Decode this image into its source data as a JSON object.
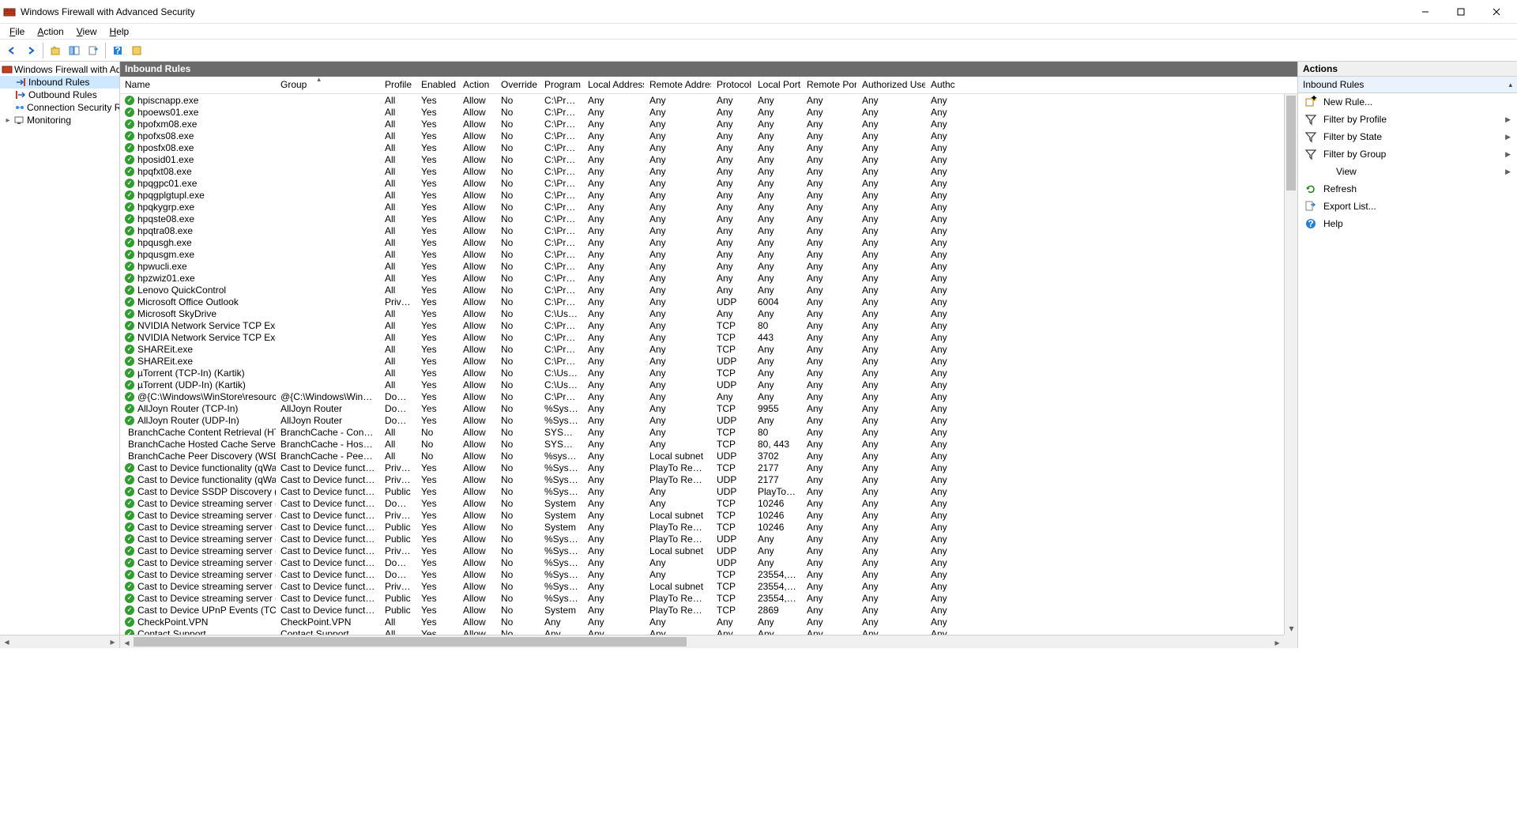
{
  "window": {
    "title": "Windows Firewall with Advanced Security"
  },
  "menu": [
    "File",
    "Action",
    "View",
    "Help"
  ],
  "tree": {
    "root": "Windows Firewall with Advance",
    "items": [
      "Inbound Rules",
      "Outbound Rules",
      "Connection Security Rules",
      "Monitoring"
    ]
  },
  "list_title": "Inbound Rules",
  "columns": [
    "Name",
    "Group",
    "Profile",
    "Enabled",
    "Action",
    "Override",
    "Program",
    "Local Address",
    "Remote Address",
    "Protocol",
    "Local Port",
    "Remote Port",
    "Authorized Users",
    "Authc"
  ],
  "rules": [
    {
      "icon": "on",
      "name": "hpiscnapp.exe",
      "group": "",
      "profile": "All",
      "enabled": "Yes",
      "action": "Allow",
      "override": "No",
      "program": "C:\\Progr...",
      "laddr": "Any",
      "raddr": "Any",
      "proto": "Any",
      "lport": "Any",
      "rport": "Any",
      "auth": "Any",
      "authc": "Any"
    },
    {
      "icon": "on",
      "name": "hpoews01.exe",
      "group": "",
      "profile": "All",
      "enabled": "Yes",
      "action": "Allow",
      "override": "No",
      "program": "C:\\Progr...",
      "laddr": "Any",
      "raddr": "Any",
      "proto": "Any",
      "lport": "Any",
      "rport": "Any",
      "auth": "Any",
      "authc": "Any"
    },
    {
      "icon": "on",
      "name": "hpofxm08.exe",
      "group": "",
      "profile": "All",
      "enabled": "Yes",
      "action": "Allow",
      "override": "No",
      "program": "C:\\Progr...",
      "laddr": "Any",
      "raddr": "Any",
      "proto": "Any",
      "lport": "Any",
      "rport": "Any",
      "auth": "Any",
      "authc": "Any"
    },
    {
      "icon": "on",
      "name": "hpofxs08.exe",
      "group": "",
      "profile": "All",
      "enabled": "Yes",
      "action": "Allow",
      "override": "No",
      "program": "C:\\Progr...",
      "laddr": "Any",
      "raddr": "Any",
      "proto": "Any",
      "lport": "Any",
      "rport": "Any",
      "auth": "Any",
      "authc": "Any"
    },
    {
      "icon": "on",
      "name": "hposfx08.exe",
      "group": "",
      "profile": "All",
      "enabled": "Yes",
      "action": "Allow",
      "override": "No",
      "program": "C:\\Progr...",
      "laddr": "Any",
      "raddr": "Any",
      "proto": "Any",
      "lport": "Any",
      "rport": "Any",
      "auth": "Any",
      "authc": "Any"
    },
    {
      "icon": "on",
      "name": "hposid01.exe",
      "group": "",
      "profile": "All",
      "enabled": "Yes",
      "action": "Allow",
      "override": "No",
      "program": "C:\\Progr...",
      "laddr": "Any",
      "raddr": "Any",
      "proto": "Any",
      "lport": "Any",
      "rport": "Any",
      "auth": "Any",
      "authc": "Any"
    },
    {
      "icon": "on",
      "name": "hpqfxt08.exe",
      "group": "",
      "profile": "All",
      "enabled": "Yes",
      "action": "Allow",
      "override": "No",
      "program": "C:\\Progr...",
      "laddr": "Any",
      "raddr": "Any",
      "proto": "Any",
      "lport": "Any",
      "rport": "Any",
      "auth": "Any",
      "authc": "Any"
    },
    {
      "icon": "on",
      "name": "hpqgpc01.exe",
      "group": "",
      "profile": "All",
      "enabled": "Yes",
      "action": "Allow",
      "override": "No",
      "program": "C:\\Progr...",
      "laddr": "Any",
      "raddr": "Any",
      "proto": "Any",
      "lport": "Any",
      "rport": "Any",
      "auth": "Any",
      "authc": "Any"
    },
    {
      "icon": "on",
      "name": "hpqgplgtupl.exe",
      "group": "",
      "profile": "All",
      "enabled": "Yes",
      "action": "Allow",
      "override": "No",
      "program": "C:\\Progr...",
      "laddr": "Any",
      "raddr": "Any",
      "proto": "Any",
      "lport": "Any",
      "rport": "Any",
      "auth": "Any",
      "authc": "Any"
    },
    {
      "icon": "on",
      "name": "hpqkygrp.exe",
      "group": "",
      "profile": "All",
      "enabled": "Yes",
      "action": "Allow",
      "override": "No",
      "program": "C:\\Progr...",
      "laddr": "Any",
      "raddr": "Any",
      "proto": "Any",
      "lport": "Any",
      "rport": "Any",
      "auth": "Any",
      "authc": "Any"
    },
    {
      "icon": "on",
      "name": "hpqste08.exe",
      "group": "",
      "profile": "All",
      "enabled": "Yes",
      "action": "Allow",
      "override": "No",
      "program": "C:\\Progr...",
      "laddr": "Any",
      "raddr": "Any",
      "proto": "Any",
      "lport": "Any",
      "rport": "Any",
      "auth": "Any",
      "authc": "Any"
    },
    {
      "icon": "on",
      "name": "hpqtra08.exe",
      "group": "",
      "profile": "All",
      "enabled": "Yes",
      "action": "Allow",
      "override": "No",
      "program": "C:\\Progr...",
      "laddr": "Any",
      "raddr": "Any",
      "proto": "Any",
      "lport": "Any",
      "rport": "Any",
      "auth": "Any",
      "authc": "Any"
    },
    {
      "icon": "on",
      "name": "hpqusgh.exe",
      "group": "",
      "profile": "All",
      "enabled": "Yes",
      "action": "Allow",
      "override": "No",
      "program": "C:\\Progr...",
      "laddr": "Any",
      "raddr": "Any",
      "proto": "Any",
      "lport": "Any",
      "rport": "Any",
      "auth": "Any",
      "authc": "Any"
    },
    {
      "icon": "on",
      "name": "hpqusgm.exe",
      "group": "",
      "profile": "All",
      "enabled": "Yes",
      "action": "Allow",
      "override": "No",
      "program": "C:\\Progr...",
      "laddr": "Any",
      "raddr": "Any",
      "proto": "Any",
      "lport": "Any",
      "rport": "Any",
      "auth": "Any",
      "authc": "Any"
    },
    {
      "icon": "on",
      "name": "hpwucli.exe",
      "group": "",
      "profile": "All",
      "enabled": "Yes",
      "action": "Allow",
      "override": "No",
      "program": "C:\\Progr...",
      "laddr": "Any",
      "raddr": "Any",
      "proto": "Any",
      "lport": "Any",
      "rport": "Any",
      "auth": "Any",
      "authc": "Any"
    },
    {
      "icon": "on",
      "name": "hpzwiz01.exe",
      "group": "",
      "profile": "All",
      "enabled": "Yes",
      "action": "Allow",
      "override": "No",
      "program": "C:\\Progr...",
      "laddr": "Any",
      "raddr": "Any",
      "proto": "Any",
      "lport": "Any",
      "rport": "Any",
      "auth": "Any",
      "authc": "Any"
    },
    {
      "icon": "on",
      "name": "Lenovo QuickControl",
      "group": "",
      "profile": "All",
      "enabled": "Yes",
      "action": "Allow",
      "override": "No",
      "program": "C:\\Progr...",
      "laddr": "Any",
      "raddr": "Any",
      "proto": "Any",
      "lport": "Any",
      "rport": "Any",
      "auth": "Any",
      "authc": "Any"
    },
    {
      "icon": "on",
      "name": "Microsoft Office Outlook",
      "group": "",
      "profile": "Private",
      "enabled": "Yes",
      "action": "Allow",
      "override": "No",
      "program": "C:\\Progr...",
      "laddr": "Any",
      "raddr": "Any",
      "proto": "UDP",
      "lport": "6004",
      "rport": "Any",
      "auth": "Any",
      "authc": "Any"
    },
    {
      "icon": "on",
      "name": "Microsoft SkyDrive",
      "group": "",
      "profile": "All",
      "enabled": "Yes",
      "action": "Allow",
      "override": "No",
      "program": "C:\\Users\\...",
      "laddr": "Any",
      "raddr": "Any",
      "proto": "Any",
      "lport": "Any",
      "rport": "Any",
      "auth": "Any",
      "authc": "Any"
    },
    {
      "icon": "on",
      "name": "NVIDIA Network Service TCP Exception (...",
      "group": "",
      "profile": "All",
      "enabled": "Yes",
      "action": "Allow",
      "override": "No",
      "program": "C:\\Progr...",
      "laddr": "Any",
      "raddr": "Any",
      "proto": "TCP",
      "lport": "80",
      "rport": "Any",
      "auth": "Any",
      "authc": "Any"
    },
    {
      "icon": "on",
      "name": "NVIDIA Network Service TCP Exception (...",
      "group": "",
      "profile": "All",
      "enabled": "Yes",
      "action": "Allow",
      "override": "No",
      "program": "C:\\Progr...",
      "laddr": "Any",
      "raddr": "Any",
      "proto": "TCP",
      "lport": "443",
      "rport": "Any",
      "auth": "Any",
      "authc": "Any"
    },
    {
      "icon": "on",
      "name": "SHAREit.exe",
      "group": "",
      "profile": "All",
      "enabled": "Yes",
      "action": "Allow",
      "override": "No",
      "program": "C:\\Progr...",
      "laddr": "Any",
      "raddr": "Any",
      "proto": "TCP",
      "lport": "Any",
      "rport": "Any",
      "auth": "Any",
      "authc": "Any"
    },
    {
      "icon": "on",
      "name": "SHAREit.exe",
      "group": "",
      "profile": "All",
      "enabled": "Yes",
      "action": "Allow",
      "override": "No",
      "program": "C:\\Progr...",
      "laddr": "Any",
      "raddr": "Any",
      "proto": "UDP",
      "lport": "Any",
      "rport": "Any",
      "auth": "Any",
      "authc": "Any"
    },
    {
      "icon": "on",
      "name": "µTorrent (TCP-In) (Kartik)",
      "group": "",
      "profile": "All",
      "enabled": "Yes",
      "action": "Allow",
      "override": "No",
      "program": "C:\\Users\\...",
      "laddr": "Any",
      "raddr": "Any",
      "proto": "TCP",
      "lport": "Any",
      "rport": "Any",
      "auth": "Any",
      "authc": "Any"
    },
    {
      "icon": "on",
      "name": "µTorrent (UDP-In) (Kartik)",
      "group": "",
      "profile": "All",
      "enabled": "Yes",
      "action": "Allow",
      "override": "No",
      "program": "C:\\Users\\...",
      "laddr": "Any",
      "raddr": "Any",
      "proto": "UDP",
      "lport": "Any",
      "rport": "Any",
      "auth": "Any",
      "authc": "Any"
    },
    {
      "icon": "on",
      "name": "@{C:\\Windows\\WinStore\\resources.pri?...",
      "group": "@{C:\\Windows\\WinStore\\resources...",
      "profile": "Domai...",
      "enabled": "Yes",
      "action": "Allow",
      "override": "No",
      "program": "C:\\Progr...",
      "laddr": "Any",
      "raddr": "Any",
      "proto": "Any",
      "lport": "Any",
      "rport": "Any",
      "auth": "Any",
      "authc": "Any"
    },
    {
      "icon": "on",
      "name": "AllJoyn Router (TCP-In)",
      "group": "AllJoyn Router",
      "profile": "Domai...",
      "enabled": "Yes",
      "action": "Allow",
      "override": "No",
      "program": "%System...",
      "laddr": "Any",
      "raddr": "Any",
      "proto": "TCP",
      "lport": "9955",
      "rport": "Any",
      "auth": "Any",
      "authc": "Any"
    },
    {
      "icon": "on",
      "name": "AllJoyn Router (UDP-In)",
      "group": "AllJoyn Router",
      "profile": "Domai...",
      "enabled": "Yes",
      "action": "Allow",
      "override": "No",
      "program": "%System...",
      "laddr": "Any",
      "raddr": "Any",
      "proto": "UDP",
      "lport": "Any",
      "rport": "Any",
      "auth": "Any",
      "authc": "Any"
    },
    {
      "icon": "off",
      "name": "BranchCache Content Retrieval (HTTP-In)",
      "group": "BranchCache - Content Retr...",
      "profile": "All",
      "enabled": "No",
      "action": "Allow",
      "override": "No",
      "program": "SYSTEM",
      "laddr": "Any",
      "raddr": "Any",
      "proto": "TCP",
      "lport": "80",
      "rport": "Any",
      "auth": "Any",
      "authc": "Any"
    },
    {
      "icon": "off",
      "name": "BranchCache Hosted Cache Server (HTT...",
      "group": "BranchCache - Hosted Cach...",
      "profile": "All",
      "enabled": "No",
      "action": "Allow",
      "override": "No",
      "program": "SYSTEM",
      "laddr": "Any",
      "raddr": "Any",
      "proto": "TCP",
      "lport": "80, 443",
      "rport": "Any",
      "auth": "Any",
      "authc": "Any"
    },
    {
      "icon": "off",
      "name": "BranchCache Peer Discovery (WSD-In)",
      "group": "BranchCache - Peer Discove...",
      "profile": "All",
      "enabled": "No",
      "action": "Allow",
      "override": "No",
      "program": "%system...",
      "laddr": "Any",
      "raddr": "Local subnet",
      "proto": "UDP",
      "lport": "3702",
      "rport": "Any",
      "auth": "Any",
      "authc": "Any"
    },
    {
      "icon": "on",
      "name": "Cast to Device functionality (qWave-TCP...",
      "group": "Cast to Device functionality",
      "profile": "Private...",
      "enabled": "Yes",
      "action": "Allow",
      "override": "No",
      "program": "%System...",
      "laddr": "Any",
      "raddr": "PlayTo Renderers",
      "proto": "TCP",
      "lport": "2177",
      "rport": "Any",
      "auth": "Any",
      "authc": "Any"
    },
    {
      "icon": "on",
      "name": "Cast to Device functionality (qWave-UDP...",
      "group": "Cast to Device functionality",
      "profile": "Private...",
      "enabled": "Yes",
      "action": "Allow",
      "override": "No",
      "program": "%System...",
      "laddr": "Any",
      "raddr": "PlayTo Renderers",
      "proto": "UDP",
      "lport": "2177",
      "rport": "Any",
      "auth": "Any",
      "authc": "Any"
    },
    {
      "icon": "on",
      "name": "Cast to Device SSDP Discovery (UDP-In)",
      "group": "Cast to Device functionality",
      "profile": "Public",
      "enabled": "Yes",
      "action": "Allow",
      "override": "No",
      "program": "%System...",
      "laddr": "Any",
      "raddr": "Any",
      "proto": "UDP",
      "lport": "PlayTo Dis...",
      "rport": "Any",
      "auth": "Any",
      "authc": "Any"
    },
    {
      "icon": "on",
      "name": "Cast to Device streaming server (HTTP-St...",
      "group": "Cast to Device functionality",
      "profile": "Domain",
      "enabled": "Yes",
      "action": "Allow",
      "override": "No",
      "program": "System",
      "laddr": "Any",
      "raddr": "Any",
      "proto": "TCP",
      "lport": "10246",
      "rport": "Any",
      "auth": "Any",
      "authc": "Any"
    },
    {
      "icon": "on",
      "name": "Cast to Device streaming server (HTTP-St...",
      "group": "Cast to Device functionality",
      "profile": "Private",
      "enabled": "Yes",
      "action": "Allow",
      "override": "No",
      "program": "System",
      "laddr": "Any",
      "raddr": "Local subnet",
      "proto": "TCP",
      "lport": "10246",
      "rport": "Any",
      "auth": "Any",
      "authc": "Any"
    },
    {
      "icon": "on",
      "name": "Cast to Device streaming server (HTTP-St...",
      "group": "Cast to Device functionality",
      "profile": "Public",
      "enabled": "Yes",
      "action": "Allow",
      "override": "No",
      "program": "System",
      "laddr": "Any",
      "raddr": "PlayTo Renderers",
      "proto": "TCP",
      "lport": "10246",
      "rport": "Any",
      "auth": "Any",
      "authc": "Any"
    },
    {
      "icon": "on",
      "name": "Cast to Device streaming server (RTCP-St...",
      "group": "Cast to Device functionality",
      "profile": "Public",
      "enabled": "Yes",
      "action": "Allow",
      "override": "No",
      "program": "%System...",
      "laddr": "Any",
      "raddr": "PlayTo Renderers",
      "proto": "UDP",
      "lport": "Any",
      "rport": "Any",
      "auth": "Any",
      "authc": "Any"
    },
    {
      "icon": "on",
      "name": "Cast to Device streaming server (RTCP-St...",
      "group": "Cast to Device functionality",
      "profile": "Private",
      "enabled": "Yes",
      "action": "Allow",
      "override": "No",
      "program": "%System...",
      "laddr": "Any",
      "raddr": "Local subnet",
      "proto": "UDP",
      "lport": "Any",
      "rport": "Any",
      "auth": "Any",
      "authc": "Any"
    },
    {
      "icon": "on",
      "name": "Cast to Device streaming server (RTCP-St...",
      "group": "Cast to Device functionality",
      "profile": "Domain",
      "enabled": "Yes",
      "action": "Allow",
      "override": "No",
      "program": "%System...",
      "laddr": "Any",
      "raddr": "Any",
      "proto": "UDP",
      "lport": "Any",
      "rport": "Any",
      "auth": "Any",
      "authc": "Any"
    },
    {
      "icon": "on",
      "name": "Cast to Device streaming server (RTSP-Str...",
      "group": "Cast to Device functionality",
      "profile": "Domain",
      "enabled": "Yes",
      "action": "Allow",
      "override": "No",
      "program": "%System...",
      "laddr": "Any",
      "raddr": "Any",
      "proto": "TCP",
      "lport": "23554, 235...",
      "rport": "Any",
      "auth": "Any",
      "authc": "Any"
    },
    {
      "icon": "on",
      "name": "Cast to Device streaming server (RTSP-Str...",
      "group": "Cast to Device functionality",
      "profile": "Private",
      "enabled": "Yes",
      "action": "Allow",
      "override": "No",
      "program": "%System...",
      "laddr": "Any",
      "raddr": "Local subnet",
      "proto": "TCP",
      "lport": "23554, 235...",
      "rport": "Any",
      "auth": "Any",
      "authc": "Any"
    },
    {
      "icon": "on",
      "name": "Cast to Device streaming server (RTSP-Str...",
      "group": "Cast to Device functionality",
      "profile": "Public",
      "enabled": "Yes",
      "action": "Allow",
      "override": "No",
      "program": "%System...",
      "laddr": "Any",
      "raddr": "PlayTo Renderers",
      "proto": "TCP",
      "lport": "23554, 235...",
      "rport": "Any",
      "auth": "Any",
      "authc": "Any"
    },
    {
      "icon": "on",
      "name": "Cast to Device UPnP Events (TCP-In)",
      "group": "Cast to Device functionality",
      "profile": "Public",
      "enabled": "Yes",
      "action": "Allow",
      "override": "No",
      "program": "System",
      "laddr": "Any",
      "raddr": "PlayTo Renderers",
      "proto": "TCP",
      "lport": "2869",
      "rport": "Any",
      "auth": "Any",
      "authc": "Any"
    },
    {
      "icon": "on",
      "name": "CheckPoint.VPN",
      "group": "CheckPoint.VPN",
      "profile": "All",
      "enabled": "Yes",
      "action": "Allow",
      "override": "No",
      "program": "Any",
      "laddr": "Any",
      "raddr": "Any",
      "proto": "Any",
      "lport": "Any",
      "rport": "Any",
      "auth": "Any",
      "authc": "Any"
    },
    {
      "icon": "on",
      "name": "Contact Support",
      "group": "Contact Support",
      "profile": "All",
      "enabled": "Yes",
      "action": "Allow",
      "override": "No",
      "program": "Any",
      "laddr": "Any",
      "raddr": "Any",
      "proto": "Any",
      "lport": "Any",
      "rport": "Any",
      "auth": "Any",
      "authc": "Any"
    }
  ],
  "actions": {
    "title": "Actions",
    "section": "Inbound Rules",
    "items": [
      {
        "label": "New Rule...",
        "icon": "new-rule",
        "sub": false
      },
      {
        "label": "Filter by Profile",
        "icon": "filter",
        "sub": true
      },
      {
        "label": "Filter by State",
        "icon": "filter",
        "sub": true
      },
      {
        "label": "Filter by Group",
        "icon": "filter",
        "sub": true
      },
      {
        "label": "View",
        "icon": "",
        "sub": true,
        "indent": true
      },
      {
        "label": "Refresh",
        "icon": "refresh",
        "sub": false
      },
      {
        "label": "Export List...",
        "icon": "export",
        "sub": false
      },
      {
        "label": "Help",
        "icon": "help",
        "sub": false
      }
    ]
  }
}
